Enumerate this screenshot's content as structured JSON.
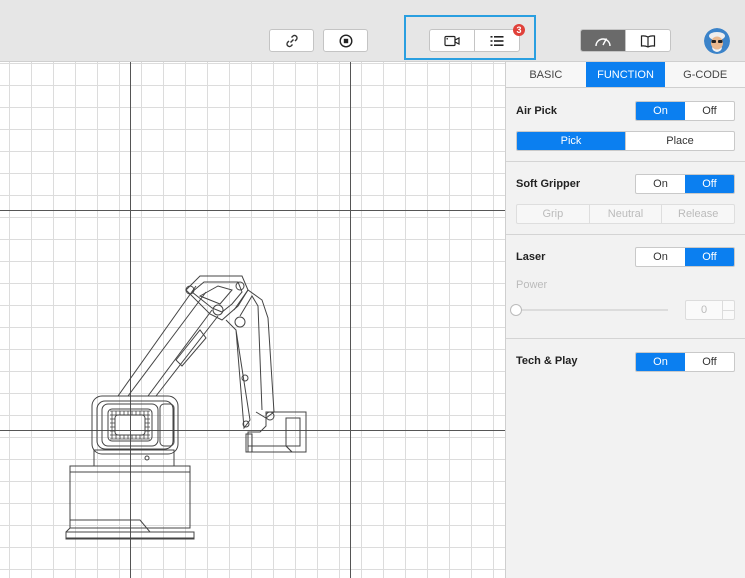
{
  "toolbar": {
    "link_icon": "link-icon",
    "stop_icon": "stop-icon",
    "camera_icon": "video-camera-icon",
    "list_icon": "list-icon",
    "badge_count": "3",
    "speed_icon": "gauge-icon",
    "book_icon": "book-icon",
    "avatar_icon": "user-avatar"
  },
  "tabs": [
    {
      "label": "BASIC"
    },
    {
      "label": "FUNCTION"
    },
    {
      "label": "G-CODE"
    }
  ],
  "air_pick": {
    "title": "Air Pick",
    "on_label": "On",
    "off_label": "Off",
    "state": "On",
    "pick_label": "Pick",
    "place_label": "Place"
  },
  "soft_gripper": {
    "title": "Soft Gripper",
    "on_label": "On",
    "off_label": "Off",
    "state": "Off",
    "grip_label": "Grip",
    "neutral_label": "Neutral",
    "release_label": "Release"
  },
  "laser": {
    "title": "Laser",
    "on_label": "On",
    "off_label": "Off",
    "state": "Off",
    "power_label": "Power",
    "power_value": "0"
  },
  "tech_play": {
    "title": "Tech & Play",
    "on_label": "On",
    "off_label": "Off",
    "state": "On"
  },
  "colors": {
    "accent": "#0b7ff0",
    "highlight": "#2a9fe0",
    "badge": "#e0413a"
  }
}
